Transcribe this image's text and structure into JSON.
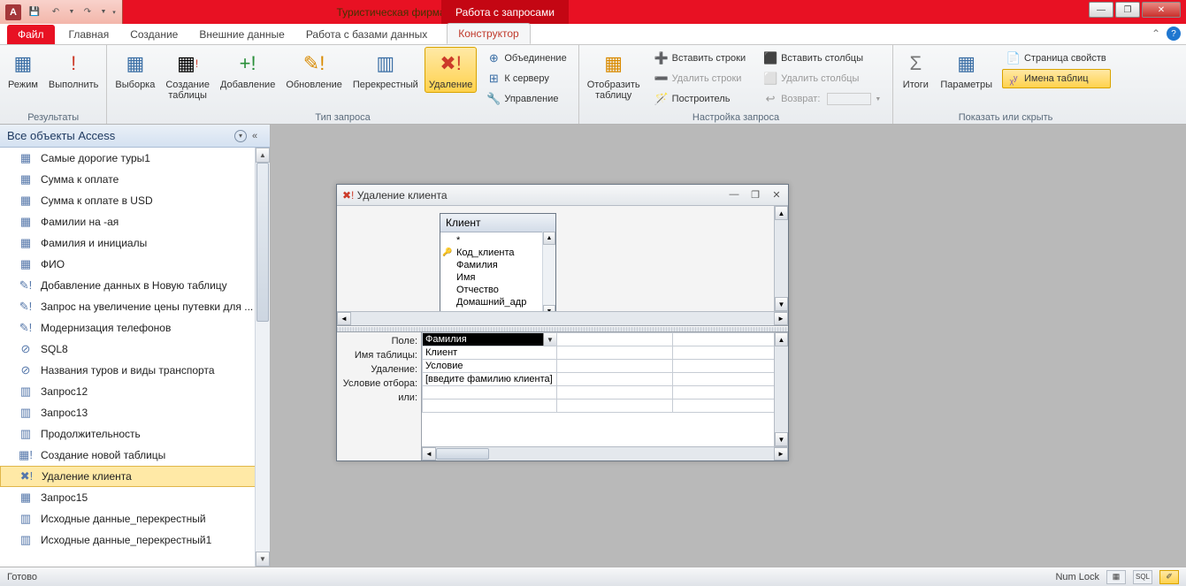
{
  "titlebar": {
    "app_title": "Туристическая фирма \"АлатанТур\"",
    "context_tab": "Работа с запросами"
  },
  "tabs": {
    "file": "Файл",
    "home": "Главная",
    "create": "Создание",
    "external": "Внешние данные",
    "dbtools": "Работа с базами данных",
    "design": "Конструктор"
  },
  "ribbon": {
    "results": {
      "label": "Результаты",
      "view": "Режим",
      "run": "Выполнить"
    },
    "qtype": {
      "label": "Тип запроса",
      "select": "Выборка",
      "maketable": "Создание\nтаблицы",
      "append": "Добавление",
      "update": "Обновление",
      "crosstab": "Перекрестный",
      "delete": "Удаление",
      "union": "Объединение",
      "passthrough": "К серверу",
      "datadef": "Управление"
    },
    "setup": {
      "label": "Настройка запроса",
      "showtable": "Отобразить\nтаблицу",
      "insrows": "Вставить строки",
      "delrows": "Удалить строки",
      "builder": "Построитель",
      "inscols": "Вставить столбцы",
      "delcols": "Удалить столбцы",
      "return": "Возврат:"
    },
    "showhide": {
      "label": "Показать или скрыть",
      "totals": "Итоги",
      "params": "Параметры",
      "propsheet": "Страница свойств",
      "tablenames": "Имена таблиц"
    }
  },
  "nav": {
    "header": "Все объекты Access",
    "items": [
      "Самые дорогие туры1",
      "Сумма к оплате",
      "Сумма к оплате в USD",
      "Фамилии на -ая",
      "Фамилия и инициалы",
      "ФИО",
      "Добавление данных в Новую таблицу",
      "Запрос на увеличение цены путевки для ...",
      "Модернизация телефонов",
      "SQL8",
      "Названия туров и виды транспорта",
      "Запрос12",
      "Запрос13",
      "Продолжительность",
      "Создание новой таблицы",
      "Удаление клиента",
      "Запрос15",
      "Исходные данные_перекрестный",
      "Исходные данные_перекрестный1"
    ],
    "active_index": 15,
    "icons": [
      "sel",
      "sel",
      "sel",
      "sel",
      "sel",
      "sel",
      "act",
      "act",
      "act",
      "union",
      "union",
      "ct",
      "ct",
      "ct",
      "mk",
      "del",
      "sel",
      "ct",
      "ct"
    ]
  },
  "query_window": {
    "title": "Удаление клиента",
    "table": {
      "name": "Клиент",
      "fields": [
        "*",
        "Код_клиента",
        "Фамилия",
        "Имя",
        "Отчество",
        "Домашний_адр"
      ],
      "key_index": 1
    },
    "grid_labels": [
      "Поле:",
      "Имя таблицы:",
      "Удаление:",
      "Условие отбора:",
      "или:"
    ],
    "grid_values": {
      "field": "Фамилия",
      "table": "Клиент",
      "delete": "Условие",
      "criteria": "[введите фамилию клиента]",
      "or": ""
    }
  },
  "statusbar": {
    "ready": "Готово",
    "numlock": "Num Lock",
    "sql": "SQL"
  }
}
